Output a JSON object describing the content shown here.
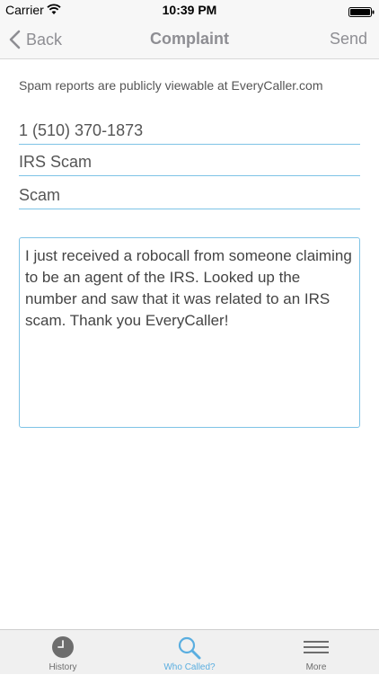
{
  "status_bar": {
    "carrier": "Carrier",
    "time": "10:39 PM",
    "icons": [
      "wifi-icon",
      "battery-icon"
    ]
  },
  "nav_bar": {
    "back_label": "Back",
    "title": "Complaint",
    "send_label": "Send",
    "back_icon": "chevron-left-icon"
  },
  "form": {
    "notice": "Spam reports are publicly viewable at EveryCaller.com",
    "phone_value": "1 (510) 370-1873",
    "subject_value": "IRS Scam",
    "category_value": "Scam",
    "comment_value": "I just received a robocall from someone claiming to be an agent of the IRS. Looked up the number and saw that it was related to an IRS scam. Thank you EveryCaller!"
  },
  "tab_bar": {
    "tabs": [
      {
        "label": "History",
        "icon": "clock-icon"
      },
      {
        "label": "Who Called?",
        "icon": "search-icon",
        "selected": true
      },
      {
        "label": "More",
        "icon": "menu-icon"
      }
    ]
  },
  "colors": {
    "accent": "#5aaee0",
    "field_border": "#7ec3e6",
    "nav_text": "#8e8e93",
    "bar_background": "#f7f7f7"
  }
}
